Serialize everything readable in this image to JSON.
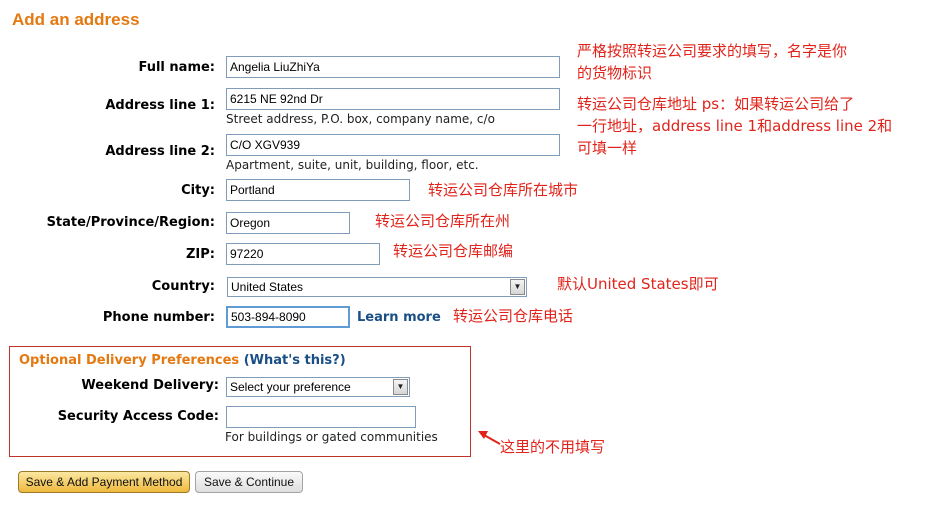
{
  "title": "Add an address",
  "fields": {
    "full_name": {
      "label": "Full name:",
      "value": "Angelia LiuZhiYa"
    },
    "address1": {
      "label": "Address line 1:",
      "value": "6215 NE 92nd Dr",
      "hint": "Street address, P.O. box, company name, c/o"
    },
    "address2": {
      "label": "Address line 2:",
      "value": "C/O XGV939",
      "hint": "Apartment, suite, unit, building, floor, etc."
    },
    "city": {
      "label": "City:",
      "value": "Portland"
    },
    "state": {
      "label": "State/Province/Region:",
      "value": "Oregon"
    },
    "zip": {
      "label": "ZIP:",
      "value": "97220"
    },
    "country": {
      "label": "Country:",
      "value": "United States"
    },
    "phone": {
      "label": "Phone number:",
      "value": "503-894-8090",
      "learn_more": "Learn more"
    }
  },
  "optional": {
    "title": "Optional Delivery Preferences",
    "paren_open": "(",
    "whats_this": "What's this?",
    "paren_close": ")",
    "weekend": {
      "label": "Weekend Delivery:",
      "value": "Select your preference"
    },
    "security": {
      "label": "Security Access Code:",
      "value": "",
      "hint": "For buildings or gated communities"
    }
  },
  "buttons": {
    "save_payment": "Save & Add Payment Method",
    "save_continue": "Save & Continue"
  },
  "annotations": {
    "name_line1": "严格按照转运公司要求的填写，名字是你",
    "name_line2": "的货物标识",
    "address_line1": "转运公司仓库地址 ps：如果转运公司给了",
    "address_line2": "一行地址，address line 1和address line 2和",
    "address_line3": "可填一样",
    "city": "转运公司仓库所在城市",
    "state": "转运公司仓库所在州",
    "zip": "转运公司仓库邮编",
    "country": "默认United States即可",
    "phone": "转运公司仓库电话",
    "optional": "这里的不用填写"
  },
  "colors": {
    "title_orange": "#e47911",
    "link_blue": "#1a4f86",
    "annotation_red": "#e0241b",
    "box_border": "#c0312b"
  }
}
